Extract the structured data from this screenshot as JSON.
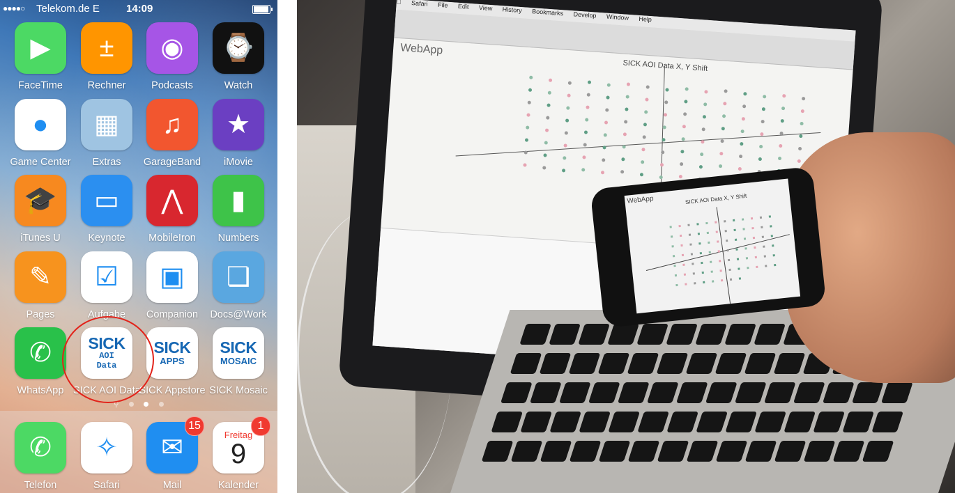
{
  "status_bar": {
    "signal": "●●●●○",
    "carrier": "Telekom.de  E",
    "time": "14:09"
  },
  "apps": [
    {
      "label": "FaceTime",
      "icon": "facetime-icon",
      "bg": "#4cd964"
    },
    {
      "label": "Rechner",
      "icon": "calculator-icon",
      "bg": "#ff9500"
    },
    {
      "label": "Podcasts",
      "icon": "podcasts-icon",
      "bg": "#a655e6"
    },
    {
      "label": "Watch",
      "icon": "watch-icon",
      "bg": "#111111"
    },
    {
      "label": "Game Center",
      "icon": "game-center-icon",
      "bg": "#ffffff"
    },
    {
      "label": "Extras",
      "icon": "folder-icon",
      "bg": "#9fc4e2"
    },
    {
      "label": "GarageBand",
      "icon": "guitar-icon",
      "bg": "#f2562f"
    },
    {
      "label": "iMovie",
      "icon": "imovie-star-icon",
      "bg": "#6b3fc2"
    },
    {
      "label": "iTunes U",
      "icon": "graduation-cap-icon",
      "bg": "#f7891f"
    },
    {
      "label": "Keynote",
      "icon": "keynote-icon",
      "bg": "#2b8ff0"
    },
    {
      "label": "MobileIron",
      "icon": "mobileiron-icon",
      "bg": "#d8272f"
    },
    {
      "label": "Numbers",
      "icon": "numbers-chart-icon",
      "bg": "#3ec349"
    },
    {
      "label": "Pages",
      "icon": "pen-icon",
      "bg": "#f7931e"
    },
    {
      "label": "Aufgabe",
      "icon": "checkbox-icon",
      "bg": "#ffffff"
    },
    {
      "label": "Companion",
      "icon": "contact-card-icon",
      "bg": "#ffffff"
    },
    {
      "label": "Docs@Work",
      "icon": "documents-icon",
      "bg": "#5aa7e0"
    },
    {
      "label": "WhatsApp",
      "icon": "whatsapp-icon",
      "bg": "#29c14a"
    },
    {
      "label": "SICK AOI Data",
      "icon": "sick-aoi-icon",
      "bg": "#ffffff",
      "brand": "SICK",
      "sub1": "AOI",
      "sub2": "Data"
    },
    {
      "label": "SICK Appstore",
      "icon": "sick-apps-icon",
      "bg": "#ffffff",
      "brand": "SICK",
      "sub1": "APPS"
    },
    {
      "label": "SICK Mosaic",
      "icon": "sick-mosaic-icon",
      "bg": "#ffffff",
      "brand": "SICK",
      "sub1": "MOSAIC"
    }
  ],
  "dock": [
    {
      "label": "Telefon",
      "icon": "phone-icon",
      "bg": "#4cd964"
    },
    {
      "label": "Safari",
      "icon": "safari-compass-icon",
      "bg": "#ffffff"
    },
    {
      "label": "Mail",
      "icon": "mail-icon",
      "bg": "#1f8ef1",
      "badge": "15"
    },
    {
      "label": "Kalender",
      "icon": "calendar-icon",
      "bg": "#ffffff",
      "badge": "1",
      "weekday": "Freitag",
      "day": "9"
    }
  ],
  "photo": {
    "menubar": [
      "Safari",
      "File",
      "Edit",
      "View",
      "History",
      "Bookmarks",
      "Develop",
      "Window",
      "Help"
    ],
    "webapp_title": "WebApp",
    "chart_title": "SICK AOI Data X, Y Shift",
    "phone_title": "WebApp",
    "phone_chart_title": "SICK AOI Data X, Y Shift"
  },
  "colors": {
    "highlight_circle": "#e2231a",
    "sick_blue": "#1667b3",
    "badge_red": "#f03a30"
  }
}
